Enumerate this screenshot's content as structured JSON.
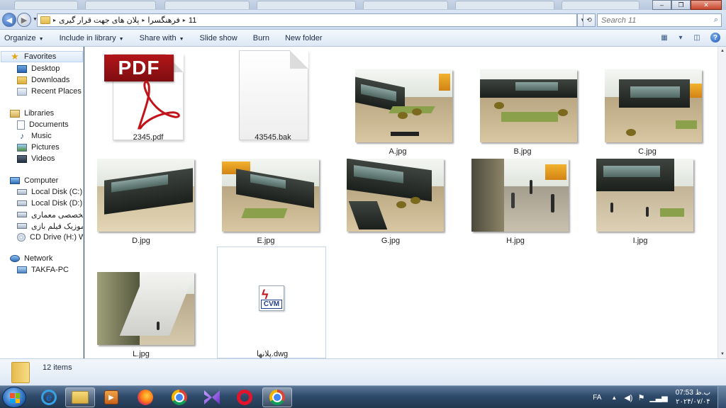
{
  "window": {
    "controls": {
      "minimize": "–",
      "maximize": "❐",
      "close": "✕"
    }
  },
  "address": {
    "breadcrumbs": [
      "11",
      "فرهنگسرا",
      "پلان های جهت قرار گیری"
    ],
    "separator": "▸",
    "search_placeholder": "Search 11"
  },
  "toolbar": {
    "items": [
      "Organize",
      "Include in library",
      "Share with",
      "Slide show",
      "Burn",
      "New folder"
    ]
  },
  "nav": {
    "favorites": {
      "label": "Favorites",
      "items": [
        "Desktop",
        "Downloads",
        "Recent Places"
      ]
    },
    "libraries": {
      "label": "Libraries",
      "items": [
        "Documents",
        "Music",
        "Pictures",
        "Videos"
      ]
    },
    "computer": {
      "label": "Computer",
      "items": [
        "Local Disk (C:)",
        "Local Disk (D:)",
        "درایو تخصصی معماری",
        "موزیک فیلم بازی (F:)",
        "CD Drive (H:) WD Un"
      ]
    },
    "network": {
      "label": "Network",
      "items": [
        "TAKFA-PC"
      ]
    }
  },
  "files": [
    {
      "name": "2345.pdf",
      "kind": "pdf",
      "icon_text": "PDF"
    },
    {
      "name": "43545.bak",
      "kind": "blank"
    },
    {
      "name": "A.jpg",
      "kind": "image"
    },
    {
      "name": "B.jpg",
      "kind": "image"
    },
    {
      "name": "C.jpg",
      "kind": "image"
    },
    {
      "name": "D.jpg",
      "kind": "image"
    },
    {
      "name": "E.jpg",
      "kind": "image"
    },
    {
      "name": "G.jpg",
      "kind": "image"
    },
    {
      "name": "H.jpg",
      "kind": "image"
    },
    {
      "name": "I.jpg",
      "kind": "image"
    },
    {
      "name": "L.jpg",
      "kind": "image"
    },
    {
      "name": "پلانها.dwg",
      "kind": "dwg",
      "icon_text": "CVM",
      "selected": true
    }
  ],
  "status": {
    "item_count": "12 items"
  },
  "taskbar": {
    "apps": [
      "internet-explorer",
      "windows-explorer",
      "media-player",
      "firefox",
      "chrome",
      "visual-studio",
      "opera",
      "chrome-profile"
    ],
    "language": "FA",
    "time": "07:53 ب.ظ",
    "date": "۲۰۲۴/۰۷/۰۴"
  }
}
